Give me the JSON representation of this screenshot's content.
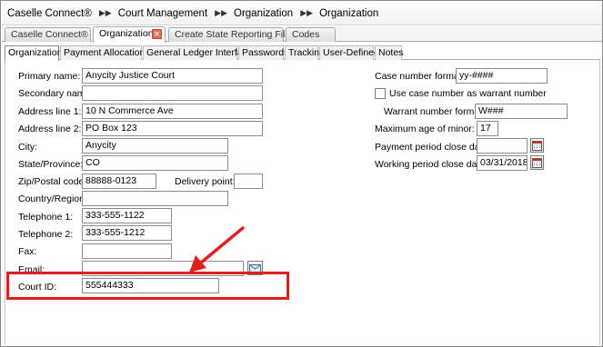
{
  "breadcrumb": [
    "Caselle Connect®",
    "Court Management",
    "Organization",
    "Organization"
  ],
  "top_tabs": [
    {
      "label": "Caselle Connect®"
    },
    {
      "label": "Organization"
    },
    {
      "label": "Create State Reporting File"
    },
    {
      "label": "Codes"
    }
  ],
  "sub_tabs": [
    "Organization",
    "Payment Allocations",
    "General Ledger Interface",
    "Passwords",
    "Tracking",
    "User-Defined",
    "Notes"
  ],
  "form": {
    "primary_name": {
      "label": "Primary name:",
      "value": "Anycity Justice Court"
    },
    "secondary_name": {
      "label": "Secondary name:",
      "value": ""
    },
    "address_line1": {
      "label": "Address line 1:",
      "value": "10 N Commerce Ave"
    },
    "address_line2": {
      "label": "Address line 2:",
      "value": "PO Box 123"
    },
    "city": {
      "label": "City:",
      "value": "Anycity"
    },
    "state": {
      "label": "State/Province:",
      "value": "CO"
    },
    "zip": {
      "label": "Zip/Postal code:",
      "value": "88888-0123"
    },
    "delivery_point": {
      "label": "Delivery point:",
      "value": ""
    },
    "country": {
      "label": "Country/Region:",
      "value": ""
    },
    "telephone1": {
      "label": "Telephone 1:",
      "value": "333-555-1122"
    },
    "telephone2": {
      "label": "Telephone 2:",
      "value": "333-555-1212"
    },
    "fax": {
      "label": "Fax:",
      "value": ""
    },
    "email": {
      "label": "Email:",
      "value": ""
    },
    "court_id": {
      "label": "Court ID:",
      "value": "555444333"
    },
    "case_number_format": {
      "label": "Case number format:",
      "value": "yy-####"
    },
    "use_case_number_warrant": {
      "label": "Use case number as warrant number",
      "checked": false
    },
    "warrant_number_format": {
      "label": "Warrant number format:",
      "value": "W###"
    },
    "max_age_minor": {
      "label": "Maximum age of minor:",
      "value": "17"
    },
    "payment_period_close": {
      "label": "Payment period close date:",
      "value": ""
    },
    "working_period_close": {
      "label": "Working period close date:",
      "value": "03/31/2018"
    }
  },
  "colors": {
    "highlight": "#e0201f",
    "tab_close": "#e3735c"
  }
}
